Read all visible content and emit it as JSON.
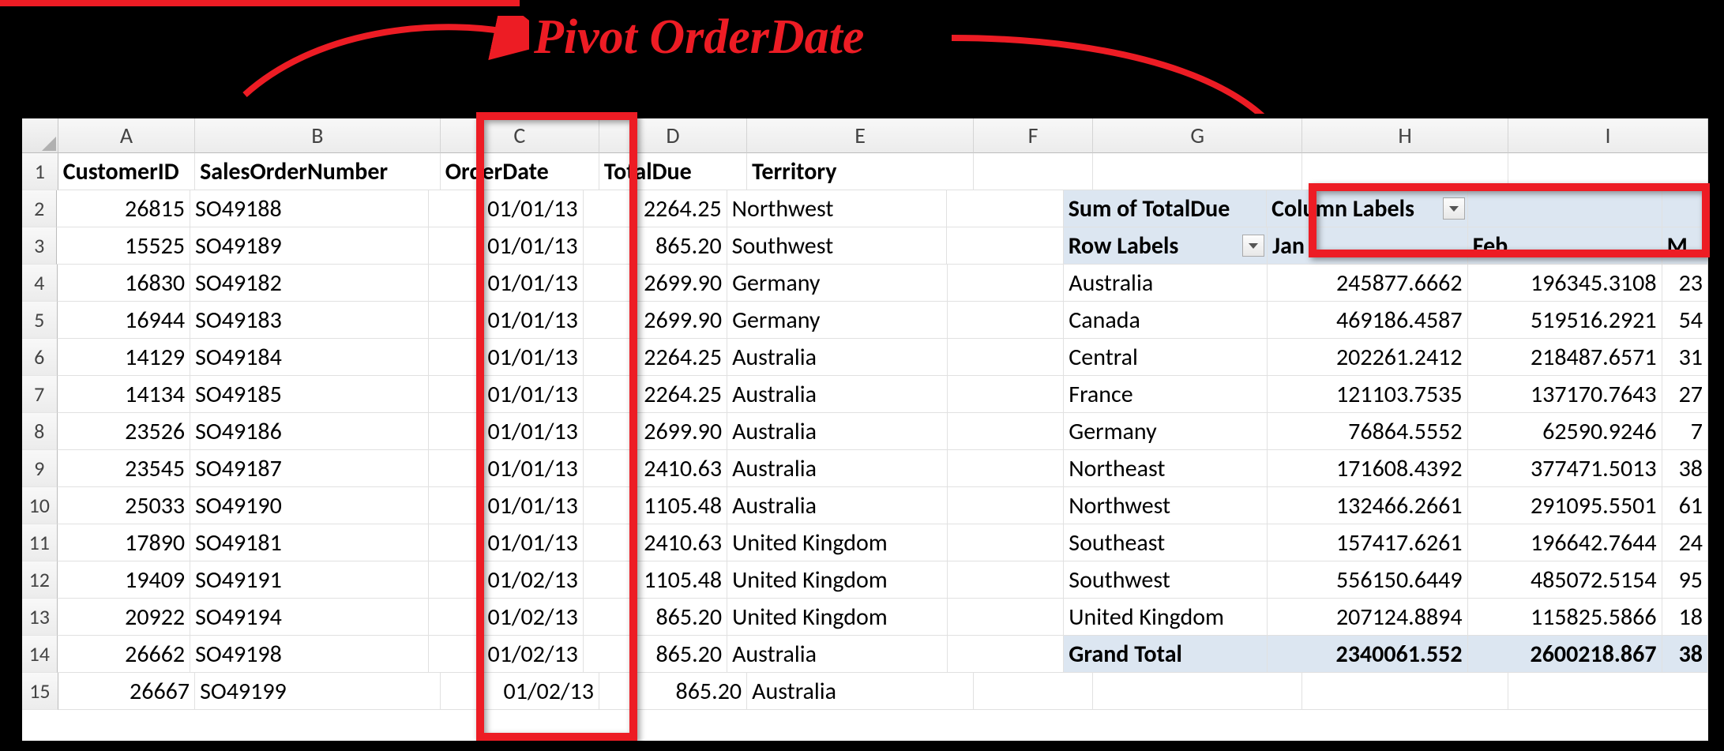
{
  "annotation": {
    "text": "Pivot OrderDate"
  },
  "columns": [
    "A",
    "B",
    "C",
    "D",
    "E",
    "F",
    "G",
    "H",
    "I"
  ],
  "header_row": {
    "A": "CustomerID",
    "B": "SalesOrderNumber",
    "C": "OrderDate",
    "D": "TotalDue",
    "E": "Territory"
  },
  "data_rows": [
    {
      "r": "2",
      "A": "26815",
      "B": "SO49188",
      "C": "01/01/13",
      "D": "2264.25",
      "E": "Northwest"
    },
    {
      "r": "3",
      "A": "15525",
      "B": "SO49189",
      "C": "01/01/13",
      "D": "865.20",
      "E": "Southwest"
    },
    {
      "r": "4",
      "A": "16830",
      "B": "SO49182",
      "C": "01/01/13",
      "D": "2699.90",
      "E": "Germany"
    },
    {
      "r": "5",
      "A": "16944",
      "B": "SO49183",
      "C": "01/01/13",
      "D": "2699.90",
      "E": "Germany"
    },
    {
      "r": "6",
      "A": "14129",
      "B": "SO49184",
      "C": "01/01/13",
      "D": "2264.25",
      "E": "Australia"
    },
    {
      "r": "7",
      "A": "14134",
      "B": "SO49185",
      "C": "01/01/13",
      "D": "2264.25",
      "E": "Australia"
    },
    {
      "r": "8",
      "A": "23526",
      "B": "SO49186",
      "C": "01/01/13",
      "D": "2699.90",
      "E": "Australia"
    },
    {
      "r": "9",
      "A": "23545",
      "B": "SO49187",
      "C": "01/01/13",
      "D": "2410.63",
      "E": "Australia"
    },
    {
      "r": "10",
      "A": "25033",
      "B": "SO49190",
      "C": "01/01/13",
      "D": "1105.48",
      "E": "Australia"
    },
    {
      "r": "11",
      "A": "17890",
      "B": "SO49181",
      "C": "01/01/13",
      "D": "2410.63",
      "E": "United Kingdom"
    },
    {
      "r": "12",
      "A": "19409",
      "B": "SO49191",
      "C": "01/02/13",
      "D": "1105.48",
      "E": "United Kingdom"
    },
    {
      "r": "13",
      "A": "20922",
      "B": "SO49194",
      "C": "01/02/13",
      "D": "865.20",
      "E": "United Kingdom"
    },
    {
      "r": "14",
      "A": "26662",
      "B": "SO49198",
      "C": "01/02/13",
      "D": "865.20",
      "E": "Australia"
    },
    {
      "r": "15",
      "A": "26667",
      "B": "SO49199",
      "C": "01/02/13",
      "D": "865.20",
      "E": "Australia"
    }
  ],
  "pivot": {
    "measure_label": "Sum of TotalDue",
    "column_labels_label": "Column Labels",
    "row_labels_label": "Row Labels",
    "col_headers": [
      "Jan",
      "Feb",
      "M"
    ],
    "rows": [
      {
        "label": "Australia",
        "H": "245877.6662",
        "I": "196345.3108",
        "J": "23"
      },
      {
        "label": "Canada",
        "H": "469186.4587",
        "I": "519516.2921",
        "J": "54"
      },
      {
        "label": "Central",
        "H": "202261.2412",
        "I": "218487.6571",
        "J": "31"
      },
      {
        "label": "France",
        "H": "121103.7535",
        "I": "137170.7643",
        "J": "27"
      },
      {
        "label": "Germany",
        "H": "76864.5552",
        "I": "62590.9246",
        "J": "7"
      },
      {
        "label": "Northeast",
        "H": "171608.4392",
        "I": "377471.5013",
        "J": "38"
      },
      {
        "label": "Northwest",
        "H": "132466.2661",
        "I": "291095.5501",
        "J": "61"
      },
      {
        "label": "Southeast",
        "H": "157417.6261",
        "I": "196642.7644",
        "J": "24"
      },
      {
        "label": "Southwest",
        "H": "556150.6449",
        "I": "485072.5154",
        "J": "95"
      },
      {
        "label": "United Kingdom",
        "H": "207124.8894",
        "I": "115825.5866",
        "J": "18"
      }
    ],
    "grand_total": {
      "label": "Grand Total",
      "H": "2340061.552",
      "I": "2600218.867",
      "J": "38"
    }
  }
}
